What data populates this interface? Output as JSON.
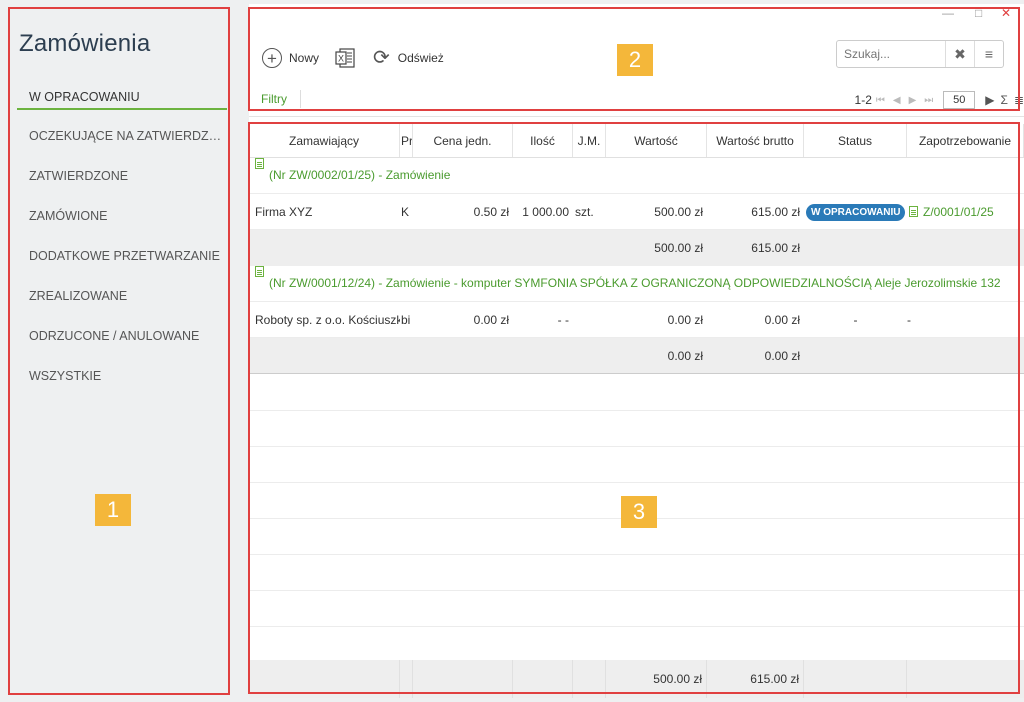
{
  "sidebar": {
    "title": "Zamówienia",
    "items": [
      {
        "label": "W OPRACOWANIU"
      },
      {
        "label": "OCZEKUJĄCE NA ZATWIERDZENIE"
      },
      {
        "label": "ZATWIERDZONE"
      },
      {
        "label": "ZAMÓWIONE"
      },
      {
        "label": "DODATKOWE PRZETWARZANIE"
      },
      {
        "label": "ZREALIZOWANE"
      },
      {
        "label": "ODRZUCONE / ANULOWANE"
      },
      {
        "label": "WSZYSTKIE"
      }
    ]
  },
  "toolbar": {
    "new_label": "Nowy",
    "refresh_label": "Odśwież",
    "search_placeholder": "Szukaj...",
    "filters_label": "Filtry"
  },
  "pager": {
    "range": "1-2",
    "page_size": "50"
  },
  "grid": {
    "columns": [
      "Zamawiający",
      "Pr",
      "Cena jedn.",
      "Ilość",
      "J.M.",
      "Wartość",
      "Wartość brutto",
      "Status",
      "Zapotrzebowanie"
    ],
    "groups": [
      {
        "title": "(Nr ZW/0002/01/25) - Zamówienie",
        "row": {
          "zamawiajacy": "Firma XYZ",
          "pr": "K",
          "cena": "0.50 zł",
          "ilosc": "1 000.00",
          "jm": "szt.",
          "wartosc": "500.00 zł",
          "brutto": "615.00 zł",
          "status": "W OPRACOWANIU",
          "zapotrzebowanie": "Z/0001/01/25"
        },
        "sum": {
          "wartosc": "500.00 zł",
          "brutto": "615.00 zł"
        }
      },
      {
        "title": "(Nr ZW/0001/12/24) - Zamówienie - komputer SYMFONIA SPÓŁKA Z OGRANICZONĄ ODPOWIEDZIALNOŚCIĄ Aleje Jerozolimskie 132",
        "row": {
          "zamawiajacy": "Roboty sp. z o.o. Kościuszko",
          "pr": "bi",
          "cena": "0.00 zł",
          "ilosc": "- -",
          "jm": "",
          "wartosc": "0.00 zł",
          "brutto": "0.00 zł",
          "status": "-",
          "zapotrzebowanie": "-"
        },
        "sum": {
          "wartosc": "0.00 zł",
          "brutto": "0.00 zł"
        }
      }
    ],
    "footer": {
      "wartosc": "500.00 zł",
      "brutto": "615.00 zł"
    }
  },
  "annotations": [
    "1",
    "2",
    "3"
  ],
  "colors": {
    "accent_green": "#6cb33f",
    "status_blue": "#2a7ab8",
    "annotation_red": "#e04040",
    "annotation_label": "#f4b73a"
  }
}
